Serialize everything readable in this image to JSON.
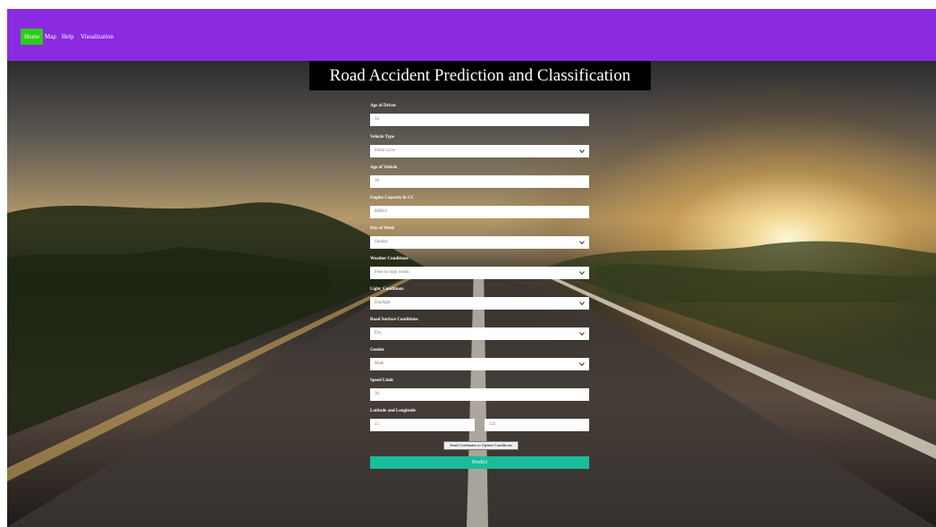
{
  "nav": {
    "items": [
      {
        "label": "Home",
        "active": true
      },
      {
        "label": "Map",
        "active": false
      },
      {
        "label": "Help",
        "active": false
      },
      {
        "label": "Visualization",
        "active": false
      }
    ]
  },
  "page": {
    "title": "Road Accident Prediction and Classification"
  },
  "form": {
    "age_of_driver": {
      "label": "Age of Driver",
      "value": "34"
    },
    "vehicle_type": {
      "label": "Vehicle Type",
      "value": "Pedal cycle"
    },
    "age_of_vehicle": {
      "label": "Age of Vehicle",
      "value": "10"
    },
    "engine_capacity": {
      "label": "Engine Capacity in CC",
      "value": "8000.0"
    },
    "day_of_week": {
      "label": "Day of Week",
      "value": "Sunday"
    },
    "weather_conditions": {
      "label": "Weather Conditions",
      "value": "Fine no high winds"
    },
    "light_conditions": {
      "label": "Light_Conditions",
      "value": "Daylight"
    },
    "road_surface": {
      "label": "Road Surface Conditions",
      "value": "Dry"
    },
    "gender": {
      "label": "Gender",
      "value": "Male"
    },
    "speed_limit": {
      "label": "Speed Limit",
      "value": "30"
    },
    "lat_long": {
      "label": "Latitude and Longitude",
      "latitude": "22",
      "longitude": "122"
    },
    "send_button": "Send Cordinates to Update Conditions",
    "predict_button": "Predict"
  },
  "colors": {
    "navbar": "#8a2be2",
    "nav_active": "#2ecc1a",
    "predict": "#1abc9c",
    "title_bg": "#000000"
  }
}
